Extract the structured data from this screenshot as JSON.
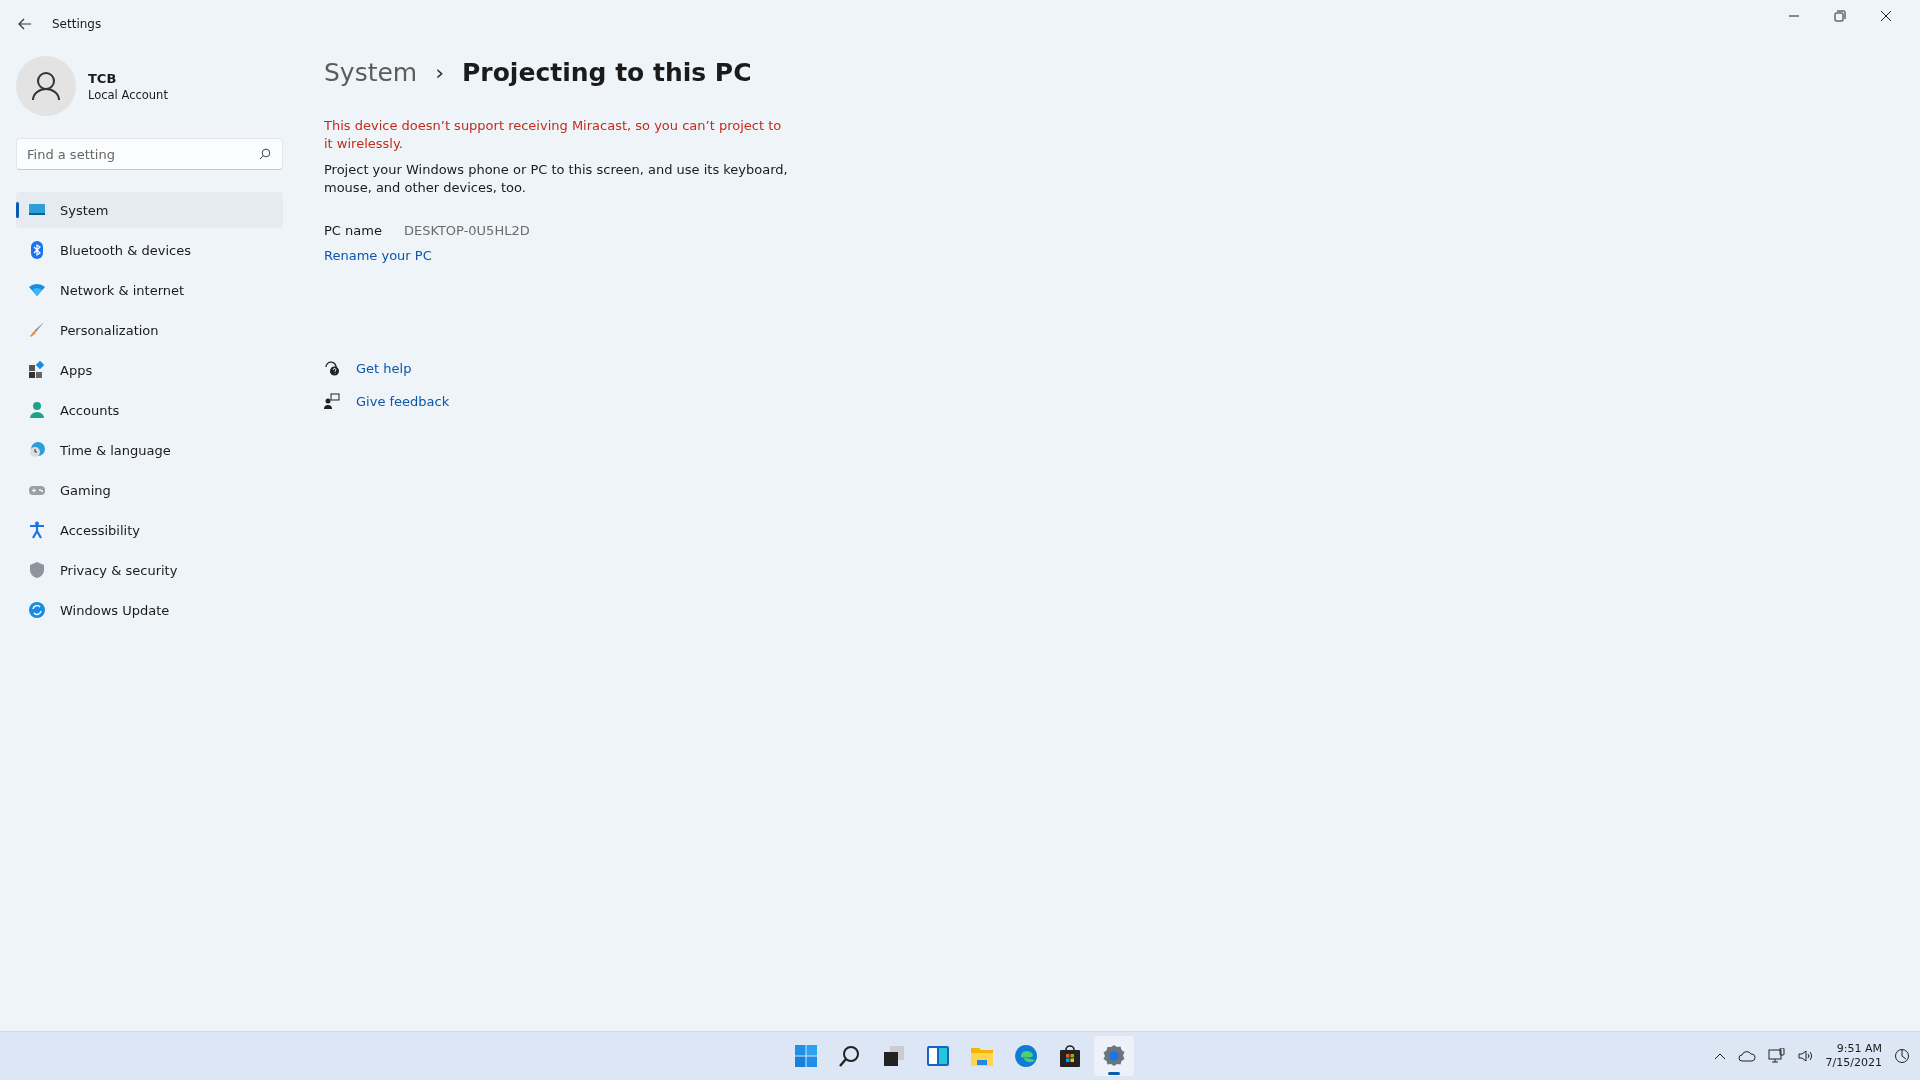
{
  "window": {
    "title": "Settings"
  },
  "account": {
    "name": "TCB",
    "type": "Local Account"
  },
  "search": {
    "placeholder": "Find a setting"
  },
  "sidebar": {
    "items": [
      {
        "label": "System",
        "selected": true
      },
      {
        "label": "Bluetooth & devices",
        "selected": false
      },
      {
        "label": "Network & internet",
        "selected": false
      },
      {
        "label": "Personalization",
        "selected": false
      },
      {
        "label": "Apps",
        "selected": false
      },
      {
        "label": "Accounts",
        "selected": false
      },
      {
        "label": "Time & language",
        "selected": false
      },
      {
        "label": "Gaming",
        "selected": false
      },
      {
        "label": "Accessibility",
        "selected": false
      },
      {
        "label": "Privacy & security",
        "selected": false
      },
      {
        "label": "Windows Update",
        "selected": false
      }
    ]
  },
  "breadcrumb": {
    "parent": "System",
    "separator": "›",
    "current": "Projecting to this PC"
  },
  "warning": "This device doesn’t support receiving Miracast, so you can’t project to it wirelessly.",
  "description": "Project your Windows phone or PC to this screen, and use its keyboard, mouse, and other devices, too.",
  "pc_name": {
    "label": "PC name",
    "value": "DESKTOP-0U5HL2D"
  },
  "rename_link": "Rename your PC",
  "help_links": [
    {
      "label": "Get help"
    },
    {
      "label": "Give feedback"
    }
  ],
  "taskbar": {
    "apps": [
      {
        "selected": false
      },
      {
        "selected": false
      },
      {
        "selected": false
      },
      {
        "selected": false
      },
      {
        "selected": false
      },
      {
        "selected": false
      },
      {
        "selected": false
      },
      {
        "selected": true
      }
    ],
    "clock": {
      "time": "9:51 AM",
      "date": "7/15/2021"
    }
  }
}
